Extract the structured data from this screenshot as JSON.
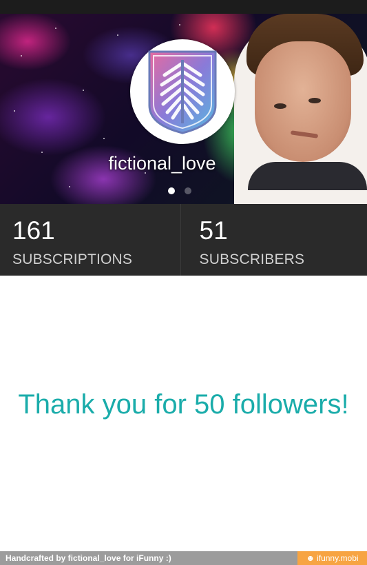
{
  "profile": {
    "username": "fictional_love",
    "pager": {
      "count": 2,
      "active": 1
    }
  },
  "stats": [
    {
      "value": "161",
      "label": "SUBSCRIPTIONS"
    },
    {
      "value": "51",
      "label": "SUBSCRIBERS"
    }
  ],
  "main": {
    "message": "Thank you for 50 followers!"
  },
  "footer": {
    "credit": "Handcrafted by fictional_love for iFunny :)",
    "brand": "ifunny.mobi",
    "brand_icon": "smiley-icon"
  },
  "colors": {
    "accent": "#1aacaa",
    "stats_bg": "#2a2a2a",
    "footer_bg": "#9c9c9c",
    "brand_bg": "#f7a442"
  },
  "icons": {
    "avatar": "wings-of-freedom-emblem-icon"
  }
}
